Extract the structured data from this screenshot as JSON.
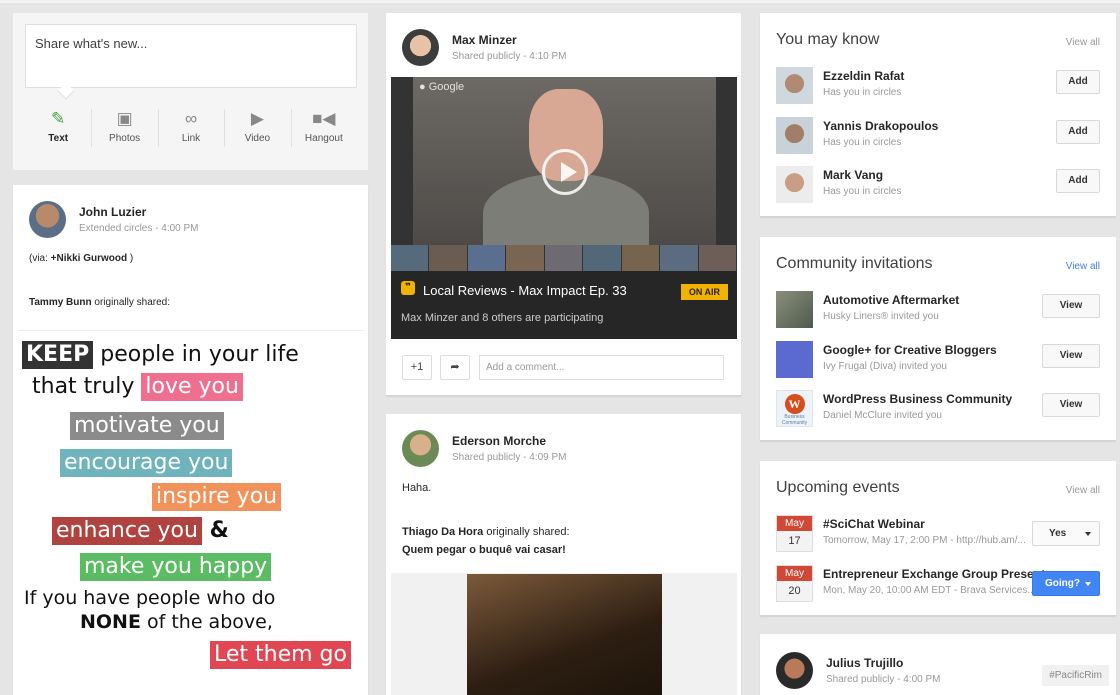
{
  "share": {
    "placeholder": "Share what's new...",
    "options": [
      {
        "label": "Text",
        "icon": "pencil-icon"
      },
      {
        "label": "Photos",
        "icon": "camera-icon"
      },
      {
        "label": "Link",
        "icon": "link-icon"
      },
      {
        "label": "Video",
        "icon": "video-play-icon"
      },
      {
        "label": "Hangout",
        "icon": "video-camera-icon"
      }
    ]
  },
  "posts": {
    "john": {
      "name": "John Luzier",
      "visibility": "Extended circles",
      "time": "4:00 PM",
      "via_prefix": "(via: ",
      "via_name": "+Nikki Gurwood",
      "via_suffix": " )",
      "shared_by": "Tammy Bunn",
      "shared_suffix": " originally shared:",
      "image_text": {
        "keep": "KEEP",
        "line1": " people in your life",
        "line2": "that truly ",
        "love": "love you",
        "motivate": "motivate you",
        "encourage": "encourage you",
        "inspire": "inspire you",
        "enhance": "enhance you",
        "amp": " &",
        "happy": "make you happy",
        "line8": "If you have people who do",
        "none": "NONE",
        "line9": " of the above,",
        "letgo": "Let them go"
      }
    },
    "max": {
      "name": "Max Minzer",
      "visibility": "Shared publicly",
      "time": "4:10 PM",
      "watermark": "Google",
      "hangout_title": "Local Reviews - Max Impact Ep. 33",
      "on_air": "ON AIR",
      "participants": "Max Minzer and 8 others are participating",
      "plus_one": "+1",
      "comment_placeholder": "Add a comment..."
    },
    "ederson": {
      "name": "Ederson Morche",
      "visibility": "Shared publicly",
      "time": "4:09 PM",
      "text": "Haha.",
      "shared_by": "Thiago Da Hora",
      "shared_suffix": " originally shared:",
      "shared_text": "Quem pegar o buquê vai casar!"
    }
  },
  "may_know": {
    "title": "You may know",
    "view_all": "View all",
    "people": [
      {
        "name": "Ezzeldin Rafat",
        "sub": "Has you in circles",
        "action": "Add"
      },
      {
        "name": "Yannis Drakopoulos",
        "sub": "Has you in circles",
        "action": "Add"
      },
      {
        "name": "Mark Vang",
        "sub": "Has you in circles",
        "action": "Add"
      }
    ]
  },
  "community": {
    "title": "Community invitations",
    "view_all": "View all",
    "items": [
      {
        "name": "Automotive Aftermarket",
        "sub": "Husky Liners® invited you",
        "action": "View"
      },
      {
        "name": "Google+ for Creative Bloggers",
        "sub": "Ivy Frugal (Diva) invited you",
        "action": "View"
      },
      {
        "name": "WordPress Business Community",
        "sub": "Daniel McClure invited you",
        "action": "View",
        "logo_text": "Business Community"
      }
    ]
  },
  "events": {
    "title": "Upcoming events",
    "view_all": "View all",
    "items": [
      {
        "month": "May",
        "day": "17",
        "name": "#SciChat Webinar",
        "sub": "Tomorrow, May 17, 2:00 PM - http://hub.am/...",
        "rsvp": "Yes"
      },
      {
        "month": "May",
        "day": "20",
        "name": "Entrepreneur Exchange Group Present...",
        "sub": "Mon, May 20, 10:00 AM EDT - Brava Services...",
        "rsvp": "Going?"
      }
    ]
  },
  "julius": {
    "name": "Julius Trujillo",
    "visibility": "Shared publicly",
    "time": "4:00 PM",
    "hashtag": "#PacificRim"
  },
  "colors": {
    "accent_blue": "#4285f4",
    "calendar_red": "#d14836",
    "on_air_yellow": "#f2b200",
    "text_green": "#48a33a"
  }
}
